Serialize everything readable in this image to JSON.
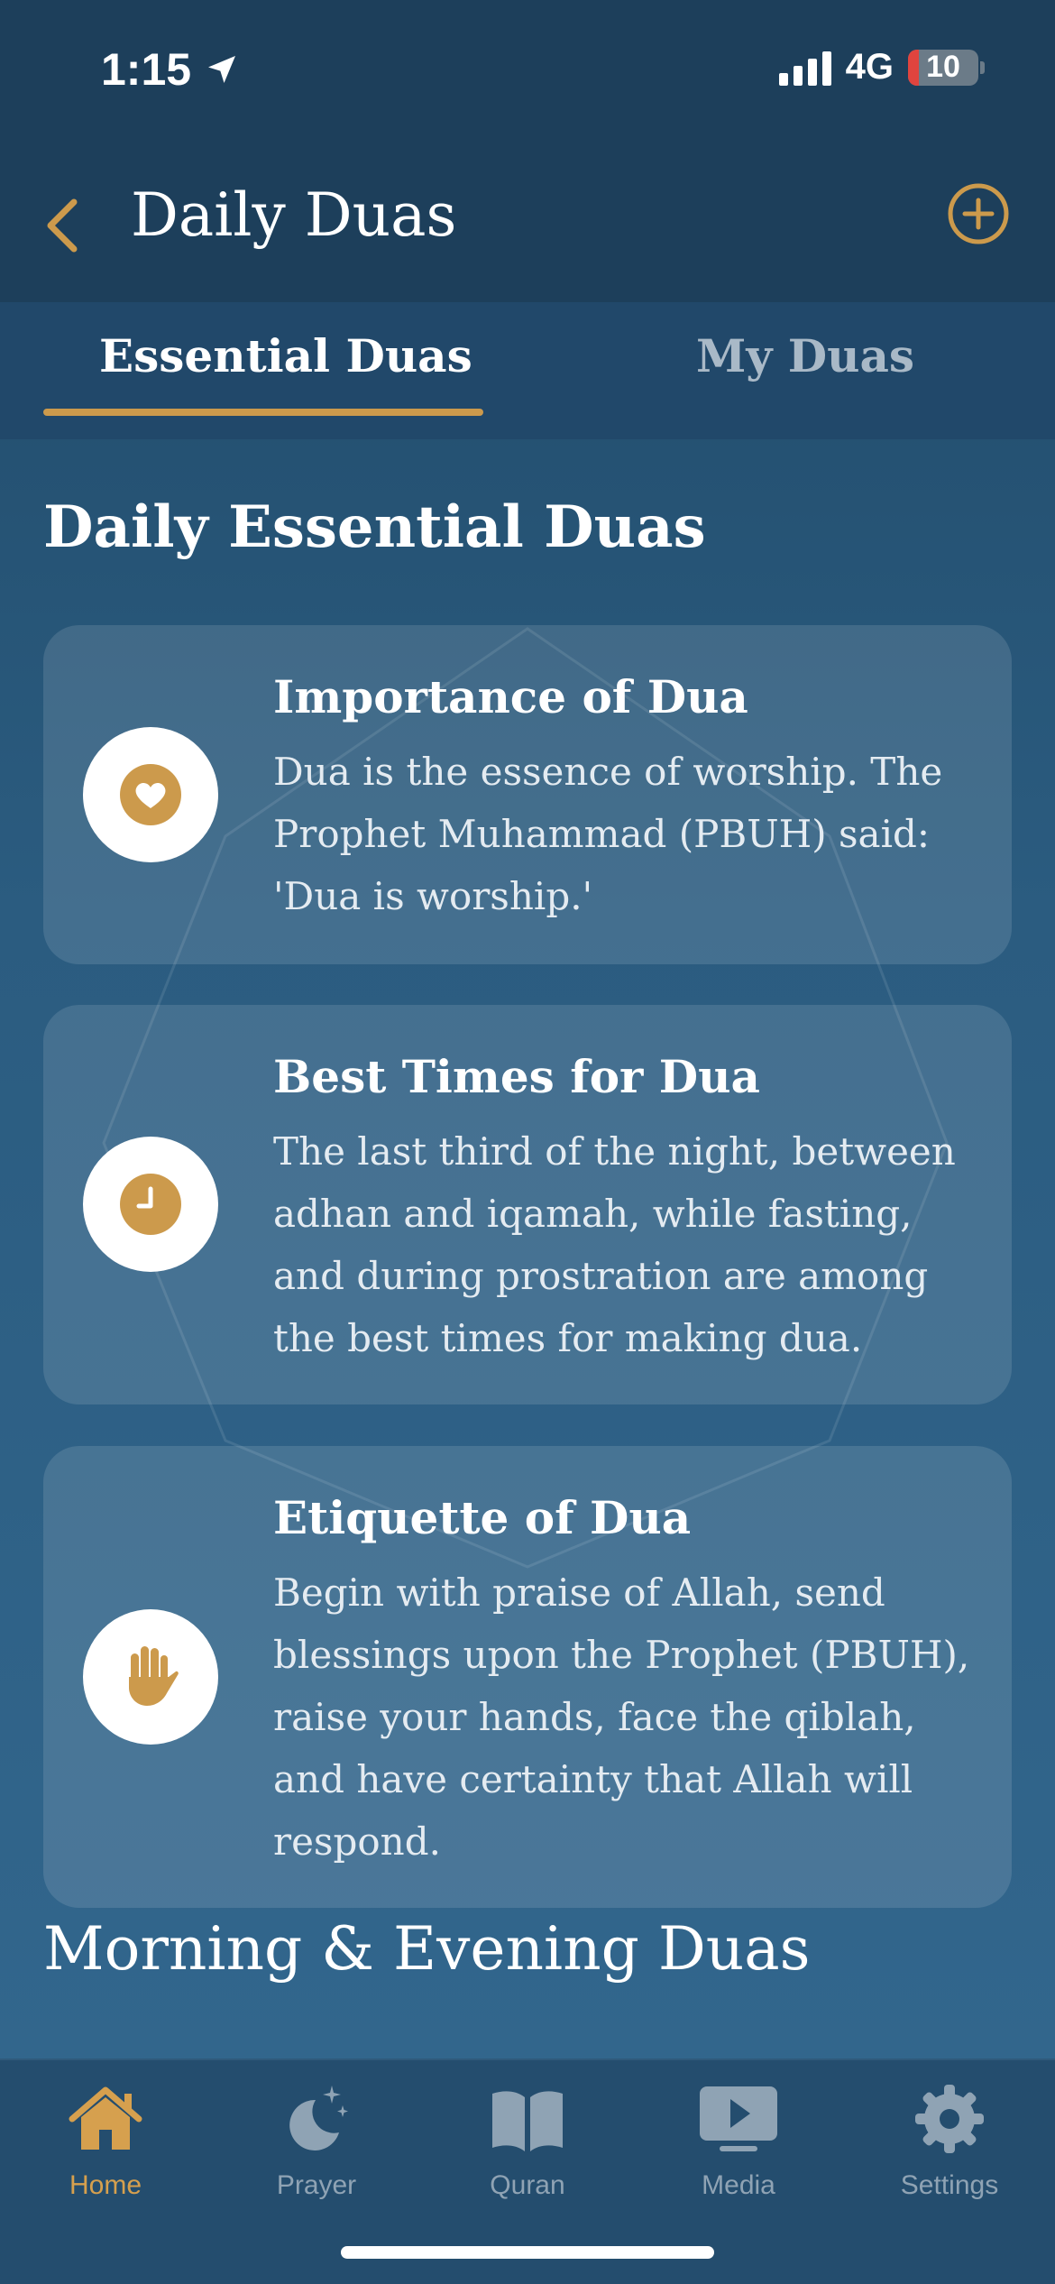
{
  "status_bar": {
    "time": "1:15",
    "network": "4G",
    "battery": "10"
  },
  "header": {
    "title": "Daily Duas",
    "back_icon": "chevron-left-icon",
    "add_icon": "plus-circle-icon"
  },
  "tabs": [
    {
      "label": "Essential Duas",
      "active": true
    },
    {
      "label": "My Duas",
      "active": false
    }
  ],
  "section_title": "Daily Essential Duas",
  "cards": [
    {
      "icon": "heart-icon",
      "title": "Importance of Dua",
      "body": "Dua is the essence of worship. The Prophet Muhammad (PBUH) said: 'Dua is worship.'"
    },
    {
      "icon": "clock-icon",
      "title": "Best Times for Dua",
      "body": "The last third of the night, between adhan and iqamah, while fasting, and during prostration are among the best times for making dua."
    },
    {
      "icon": "hand-icon",
      "title": "Etiquette of Dua",
      "body": "Begin with praise of Allah, send blessings upon the Prophet (PBUH), raise your hands, face the qiblah, and have certainty that Allah will respond."
    }
  ],
  "next_section_title": "Morning & Evening Duas",
  "tabbar": [
    {
      "label": "Home",
      "icon": "home-icon",
      "active": true
    },
    {
      "label": "Prayer",
      "icon": "moon-stars-icon",
      "active": false
    },
    {
      "label": "Quran",
      "icon": "book-icon",
      "active": false
    },
    {
      "label": "Media",
      "icon": "play-screen-icon",
      "active": false
    },
    {
      "label": "Settings",
      "icon": "gear-icon",
      "active": false
    }
  ],
  "colors": {
    "accent": "#cc9a4c",
    "header_bg": "#1d3f5b",
    "inactive": "#8fa3b4"
  }
}
